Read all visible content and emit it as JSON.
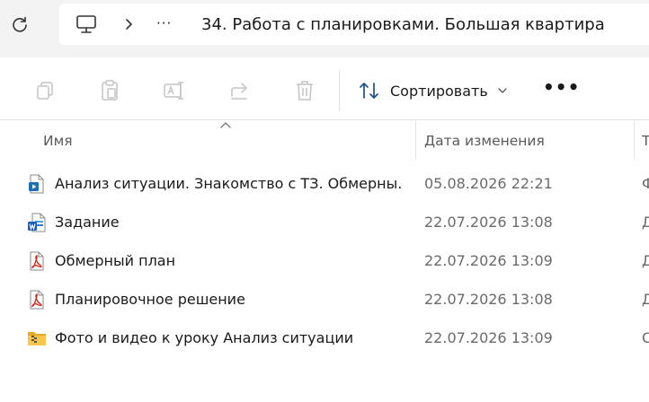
{
  "address": {
    "overflow_label": "···",
    "current_folder": "34. Работа с планировками. Большая квартира"
  },
  "toolbar": {
    "copy_icon": "copy-icon",
    "paste_icon": "paste-icon",
    "rename_icon": "rename-icon",
    "share_icon": "share-icon",
    "delete_icon": "trash-icon",
    "sort_label": "Сортировать",
    "more_label": "•••"
  },
  "columns": {
    "name": "Имя",
    "date_modified": "Дата изменения",
    "type": "Т"
  },
  "files": [
    {
      "name": "Анализ ситуации. Знакомство с ТЗ. Обмерны...",
      "date": "05.08.2026 22:21",
      "type": "Ф",
      "icon": "video-file-icon"
    },
    {
      "name": "Задание",
      "date": "22.07.2026 13:08",
      "type": "Д",
      "icon": "word-document-icon"
    },
    {
      "name": "Обмерный план",
      "date": "22.07.2026 13:09",
      "type": "Д",
      "icon": "pdf-file-icon"
    },
    {
      "name": "Планировочное решение",
      "date": "22.07.2026 13:08",
      "type": "Д",
      "icon": "pdf-file-icon"
    },
    {
      "name": "Фото и видео к уроку Анализ ситуации",
      "date": "22.07.2026 13:09",
      "type": "С",
      "icon": "zip-folder-icon"
    }
  ],
  "colors": {
    "accent": "#0067c0",
    "pdf_red": "#d52b1e",
    "word_blue": "#185abd",
    "folder_yellow": "#f8c74a"
  }
}
